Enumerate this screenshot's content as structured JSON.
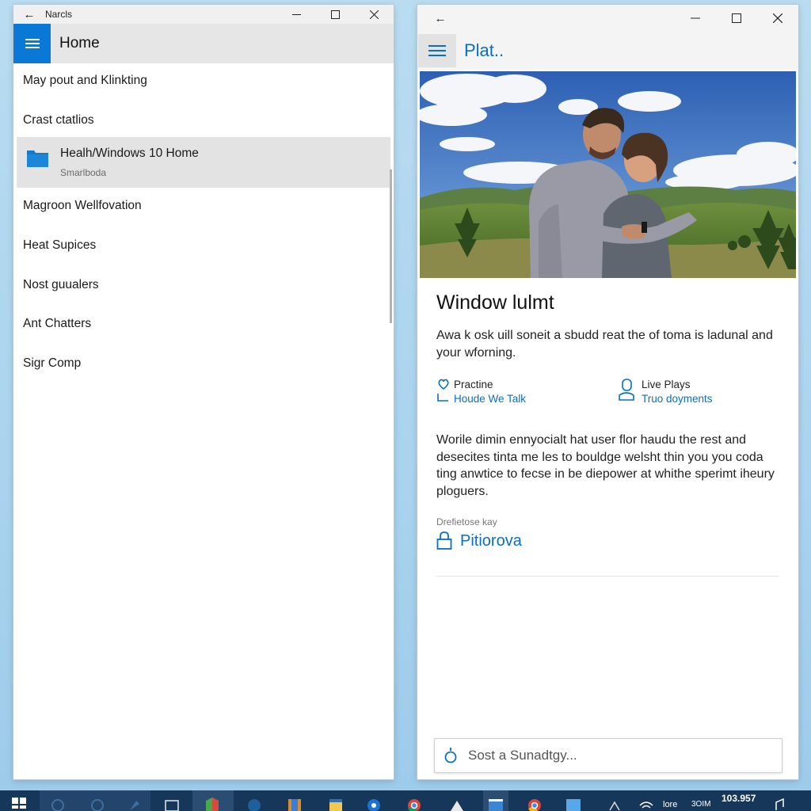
{
  "left_window": {
    "title": "Narcls",
    "header_title": "Home",
    "items": [
      {
        "label": "May pout and Klinkting"
      },
      {
        "label": "Crast ctatlios"
      },
      {
        "label": "Magroon Wellfovation"
      },
      {
        "label": "Heat Supices"
      },
      {
        "label": "Nost guualers"
      },
      {
        "label": "Ant Chatters"
      },
      {
        "label": "Sigr Comp"
      }
    ],
    "selected_item": {
      "title": "Healh/Windows 10 Home",
      "subtitle": "Smarlboda",
      "icon": "folder-icon"
    }
  },
  "right_window": {
    "header_title": "Plat..",
    "heading": "Window lulmt",
    "paragraph1": "Awa k osk uill soneit a sbudd reat the of toma is ladunal and your wforning.",
    "link1": {
      "line1": "Practine",
      "line2": "Houde We Talk",
      "icon": "heart-icon"
    },
    "link2": {
      "line1": "Live Plays",
      "line2": "Truo doyments",
      "icon": "person-icon"
    },
    "paragraph2": "Worile dimin ennyocialt hat user flor haudu the rest and desecites tinta me les to bouldge welsht thin you you coda ting anwtice to fecse in be diepower at whithe sperimt iheury ploguers.",
    "small_label": "Drefietose kay",
    "action_label": "Pitiorova",
    "action_icon": "lock-icon",
    "search_placeholder": "Sost a Sunadtgy..."
  },
  "taskbar": {
    "clock": "103.957",
    "tray_label_1": "lore",
    "tray_label_2": "3OIM"
  },
  "colors": {
    "accent": "#0a78d7",
    "link": "#0a6fc2",
    "taskbar": "#16375a",
    "desktop": "#b3d9f0"
  }
}
